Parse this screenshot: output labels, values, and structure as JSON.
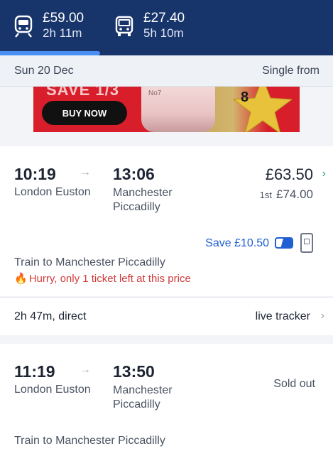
{
  "modes": {
    "train": {
      "icon": "train-icon",
      "price": "£59.00",
      "duration": "2h 11m"
    },
    "coach": {
      "icon": "bus-icon",
      "price": "£27.40",
      "duration": "5h 10m"
    }
  },
  "date_bar": {
    "date": "Sun 20 Dec",
    "fare_type": "Single from"
  },
  "ad": {
    "headline": "SAVE 1/3",
    "button": "BUY NOW",
    "jar_text": "No7",
    "star_number": "8"
  },
  "journeys": [
    {
      "depart_time": "10:19",
      "arrow": "→",
      "arrive_time": "13:06",
      "from": "London Euston",
      "to": "Manchester Piccadilly",
      "price": "£63.50",
      "first_label": "1st",
      "first_price": "£74.00",
      "save_text": "Save £10.50",
      "train_to": "Train to Manchester Piccadilly",
      "warning": "Hurry, only 1 ticket left at this price",
      "duration": "2h 47m, direct",
      "tracker": "live tracker"
    },
    {
      "depart_time": "11:19",
      "arrow": "→",
      "arrive_time": "13:50",
      "from": "London Euston",
      "to": "Manchester Piccadilly",
      "status": "Sold out",
      "train_to": "Train to Manchester Piccadilly"
    }
  ],
  "colors": {
    "header": "#17346b",
    "accent": "#1f5fd2",
    "warning": "#d23b3b",
    "indicator": "#4a8ff2"
  }
}
